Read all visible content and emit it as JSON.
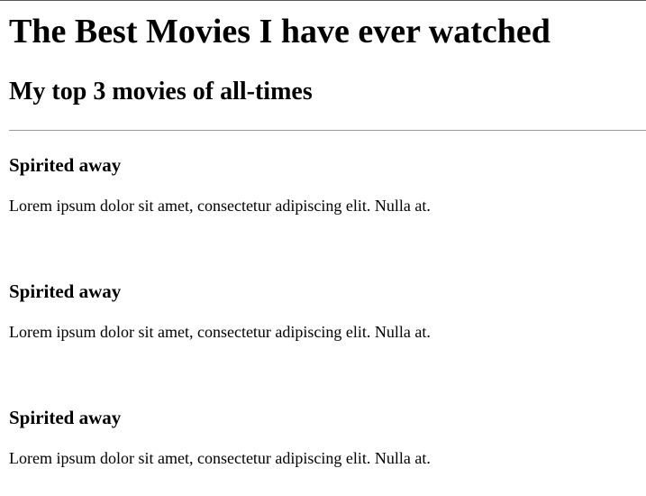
{
  "page": {
    "title": "The Best Movies I have ever watched",
    "subtitle": "My top 3 movies of all-times"
  },
  "movies": [
    {
      "title": "Spirited away",
      "description": "Lorem ipsum dolor sit amet, consectetur adipiscing elit. Nulla at."
    },
    {
      "title": "Spirited away",
      "description": "Lorem ipsum dolor sit amet, consectetur adipiscing elit. Nulla at."
    },
    {
      "title": "Spirited away",
      "description": "Lorem ipsum dolor sit amet, consectetur adipiscing elit. Nulla at."
    }
  ]
}
